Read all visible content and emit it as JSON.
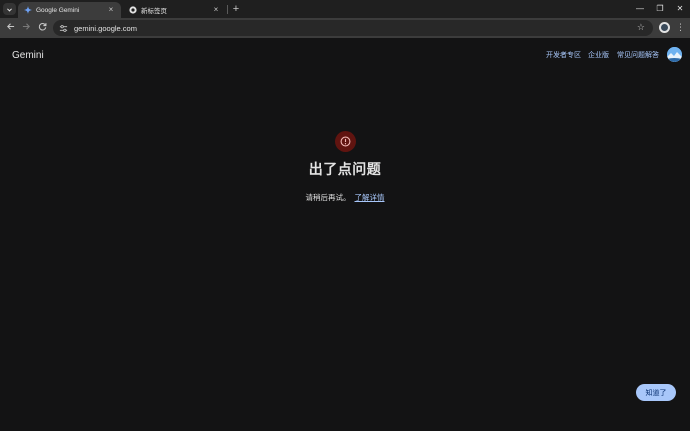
{
  "browser": {
    "tabs": [
      {
        "title": "Google Gemini",
        "active": true
      },
      {
        "title": "新标签页",
        "active": false
      }
    ],
    "url": "gemini.google.com",
    "new_tab_glyph": "+",
    "window_controls": {
      "minimize": "—",
      "maximize": "❐",
      "close": "✕"
    }
  },
  "header": {
    "brand": "Gemini",
    "nav": [
      "开发者专区",
      "企业版",
      "常见问题解答"
    ]
  },
  "error": {
    "title": "出了点问题",
    "message": "请稍后再试。",
    "link_text": "了解详情"
  },
  "toast": {
    "button_label": "知道了"
  },
  "colors": {
    "page_bg": "#131314",
    "accent": "#a8c7fa",
    "error_circle": "#601410",
    "error_icon": "#f2b8b5"
  },
  "icons": [
    "tab-search-icon",
    "gemini-favicon-icon",
    "chrome-favicon-icon",
    "close-icon",
    "back-icon",
    "forward-icon",
    "reload-icon",
    "site-info-icon",
    "star-icon",
    "profile-icon",
    "more-menu-icon",
    "alert-circle-icon",
    "avatar"
  ]
}
